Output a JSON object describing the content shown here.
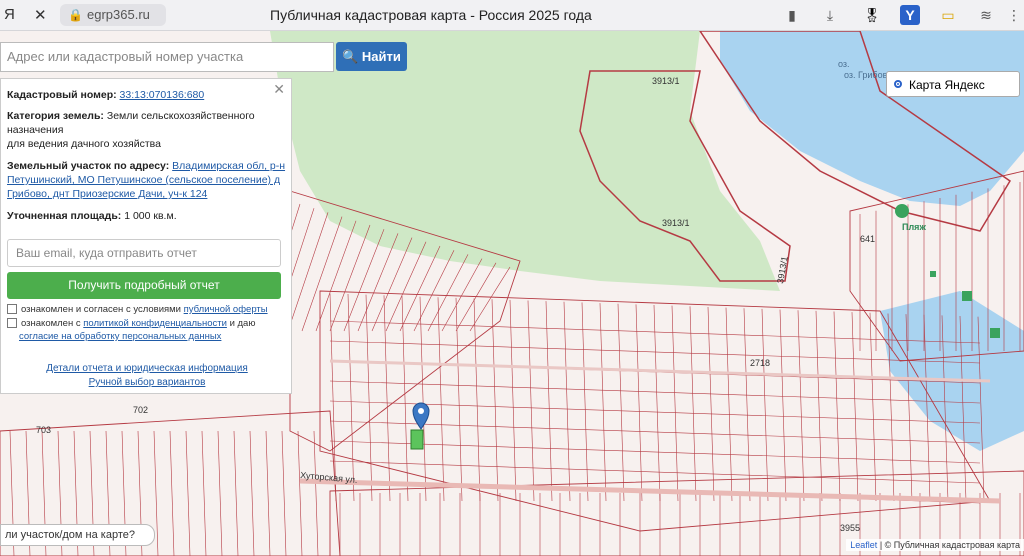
{
  "browser": {
    "url": "egrp365.ru",
    "title": "Публичная кадастровая карта - Россия 2025 года",
    "nav_icons": [
      "yandex-icon",
      "close-icon",
      "lock-icon",
      "bookmark-icon",
      "download-icon"
    ]
  },
  "search": {
    "placeholder": "Адрес или кадастровый номер участка",
    "button": "Найти"
  },
  "layer": {
    "selected": "Карта Яндекс"
  },
  "panel": {
    "cad_label": "Кадастровый номер:",
    "cad_value": "33:13:070136:680",
    "cat_label": "Категория земель:",
    "cat_value_1": "Земли сельскохозяйственного",
    "cat_value_2": "назначения",
    "cat_value_3": "для ведения дачного хозяйства",
    "addr_label": "Земельный участок по адресу:",
    "addr_value_1": "Владимирская обл, р-н",
    "addr_value_2": "Петушинский, МО Петушинское (сельское поселение) д",
    "addr_value_3": "Грибово, днт Приозерские Дачи, уч-к 124",
    "area_label": "Уточненная площадь:",
    "area_value": "1 000 кв.м.",
    "email_placeholder": "Ваш email, куда отправить отчет",
    "report_button": "Получить подробный отчет",
    "chk1_text": "ознакомлен и согласен с условиями",
    "chk1_link": "публичной оферты",
    "chk2_text": "ознакомлен с",
    "chk2_link": "политикой конфиденциальности",
    "chk2_text2": "и даю",
    "chk2_link2": "согласие на обработку персональных данных",
    "details_link": "Детали отчета и юридическая информация",
    "manual_link": "Ручной выбор вариантов"
  },
  "map_labels": {
    "lake": "оз. Грибовское",
    "parcel_a": "3913/1",
    "parcel_b": "3913/1",
    "parcel_c": "3913/1",
    "beach": "Пляж",
    "street": "Хуторская ул.",
    "l641": "641",
    "l702": "702",
    "l703": "703",
    "l3955": "3955",
    "l2718": "2718"
  },
  "bottom_question": "ли участок/дом на карте?",
  "attribution": {
    "leaflet": "Leaflet",
    "sep": " | © ",
    "source": "Публичная кадастровая карта"
  },
  "colors": {
    "accent": "#2f6fb7",
    "green": "#4cae4c",
    "parcel": "#b53a43",
    "water": "#a9d3f0",
    "forest": "#cfe8c6"
  }
}
